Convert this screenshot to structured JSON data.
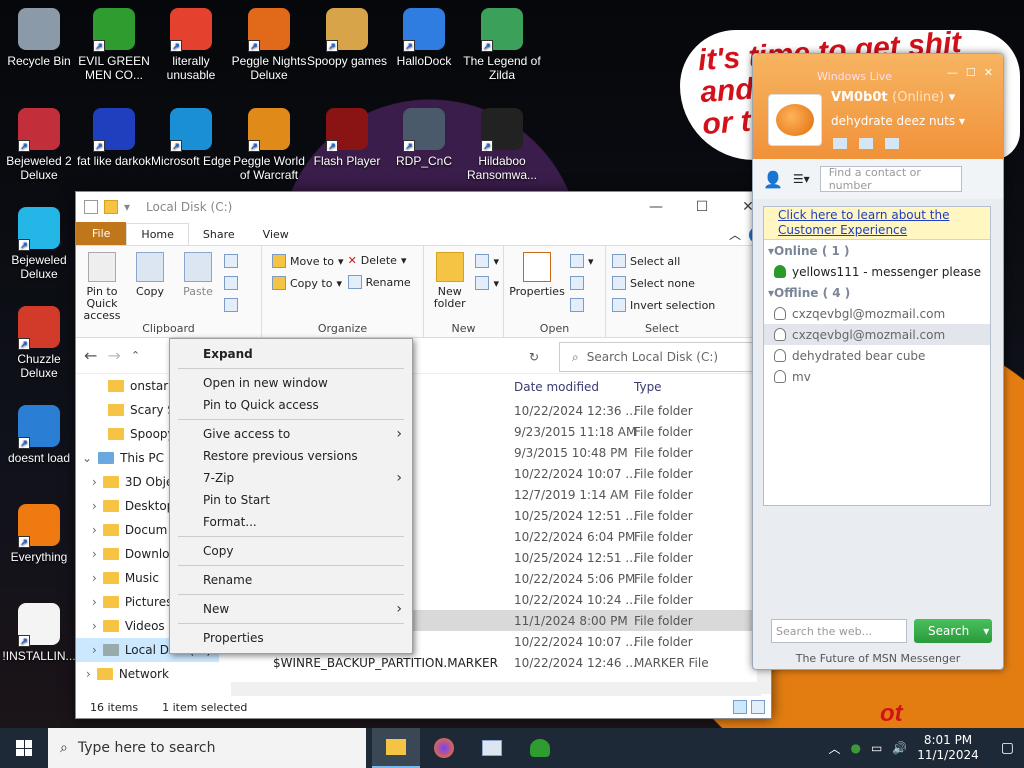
{
  "desktop": {
    "icons": [
      {
        "label": "Recycle Bin",
        "color": "#8a9aa8"
      },
      {
        "label": "EVIL GREEN MEN CO...",
        "color": "#2e9c2e"
      },
      {
        "label": "literally unusable",
        "color": "#e4412f"
      },
      {
        "label": "Peggle Nights Deluxe",
        "color": "#e06a1a"
      },
      {
        "label": "Spoopy games",
        "color": "#d7a44a"
      },
      {
        "label": "HalloDock",
        "color": "#2f7de0"
      },
      {
        "label": "The Legend of Zilda",
        "color": "#3aa05a"
      },
      {
        "label": "Bejeweled 2 Deluxe",
        "color": "#c22f3a"
      },
      {
        "label": "fat like darkok",
        "color": "#1f3fbf"
      },
      {
        "label": "Microsoft Edge",
        "color": "#1a8fd6"
      },
      {
        "label": "Peggle World of Warcraft",
        "color": "#e08a1a"
      },
      {
        "label": "Flash Player",
        "color": "#8a1414"
      },
      {
        "label": "RDP_CnC",
        "color": "#4a5a6a"
      },
      {
        "label": "Hildaboo Ransomwa...",
        "color": "#222"
      },
      {
        "label": "Bejeweled Deluxe",
        "color": "#24b6e6"
      },
      {
        "label": "Chuzzle Deluxe",
        "color": "#d23a2a"
      },
      {
        "label": "doesnt load",
        "color": "#2a7fd4"
      },
      {
        "label": "Everything",
        "color": "#f07a12"
      },
      {
        "label": "!INSTALLIN...",
        "color": "#f4f4f4"
      }
    ],
    "wall_text": "it's time to get shit\nand\nor t",
    "wall_text2": "ot"
  },
  "explorer": {
    "title": "Local Disk (C:)",
    "tabs": [
      "File",
      "Home",
      "Share",
      "View"
    ],
    "clipboard": {
      "pin": "Pin to Quick access",
      "copy": "Copy",
      "paste": "Paste",
      "label": "Clipboard"
    },
    "organize": {
      "move_to": "Move to",
      "copy_to": "Copy to",
      "delete": "Delete",
      "rename": "Rename",
      "label": "Organize"
    },
    "new": {
      "new_folder": "New folder",
      "label": "New"
    },
    "open": {
      "properties": "Properties",
      "label": "Open"
    },
    "select": {
      "all": "Select all",
      "none": "Select none",
      "invert": "Invert selection",
      "label": "Select"
    },
    "search_placeholder": "Search Local Disk (C:)",
    "nav": {
      "items": [
        {
          "label": "onstar"
        },
        {
          "label": "Scary Sh"
        },
        {
          "label": "Spoopy"
        },
        {
          "label": "This PC"
        },
        {
          "label": "3D Obje"
        },
        {
          "label": "Desktop"
        },
        {
          "label": "Docum"
        },
        {
          "label": "Downlo"
        },
        {
          "label": "Music"
        },
        {
          "label": "Pictures"
        },
        {
          "label": "Videos"
        },
        {
          "label": "Local Disk (C:)"
        },
        {
          "label": "Network"
        }
      ]
    },
    "columns": {
      "date": "Date modified",
      "type": "Type"
    },
    "rows": [
      {
        "date": "10/22/2024 12:36 ...",
        "type": "File folder"
      },
      {
        "date": "9/23/2015 11:18 AM",
        "type": "File folder"
      },
      {
        "date": "9/3/2015 10:48 PM",
        "type": "File folder"
      },
      {
        "date": "10/22/2024 10:07 ...",
        "type": "File folder"
      },
      {
        "date": "12/7/2019 1:14 AM",
        "type": "File folder"
      },
      {
        "date": "10/25/2024 12:51 ...",
        "type": "File folder"
      },
      {
        "date": "10/22/2024 6:04 PM",
        "type": "File folder"
      },
      {
        "date": "10/25/2024 12:51 ...",
        "type": "File folder"
      },
      {
        "date": "10/22/2024 5:06 PM",
        "type": "File folder"
      },
      {
        "date": "10/22/2024 10:24 ...",
        "type": "File folder"
      },
      {
        "date": "11/1/2024 8:00 PM",
        "type": "File folder"
      },
      {
        "date": "10/22/2024 10:07 ...",
        "type": "File folder"
      },
      {
        "date": "10/22/2024 12:46 ...",
        "type": "MARKER File",
        "name": "$WINRE_BACKUP_PARTITION.MARKER"
      }
    ],
    "status_items": "16 items",
    "status_selected": "1 item selected"
  },
  "context_menu": {
    "items": [
      "Expand",
      "Open in new window",
      "Pin to Quick access",
      "Give access to",
      "Restore previous versions",
      "7-Zip",
      "Pin to Start",
      "Format...",
      "Copy",
      "Rename",
      "New",
      "Properties"
    ]
  },
  "messenger": {
    "title": "Windows Live",
    "user": "VM0b0t",
    "status": "(Online)",
    "personal_msg": "dehydrate deez nuts",
    "find_placeholder": "Find a contact or number",
    "promo": "Click here to learn about the Customer Experience",
    "online_header": "Online ( 1 )",
    "offline_header": "Offline ( 4 )",
    "online": [
      "yellows111 - messenger please"
    ],
    "offline": [
      "cxzqevbgl@mozmail.com",
      "cxzqevbgl@mozmail.com",
      "dehydrated bear cube",
      "mv"
    ],
    "search_web_placeholder": "Search the web...",
    "search_button": "Search",
    "footer": "The Future of MSN Messenger"
  },
  "taskbar": {
    "search_placeholder": "Type here to search",
    "time": "8:01 PM",
    "date": "11/1/2024"
  }
}
